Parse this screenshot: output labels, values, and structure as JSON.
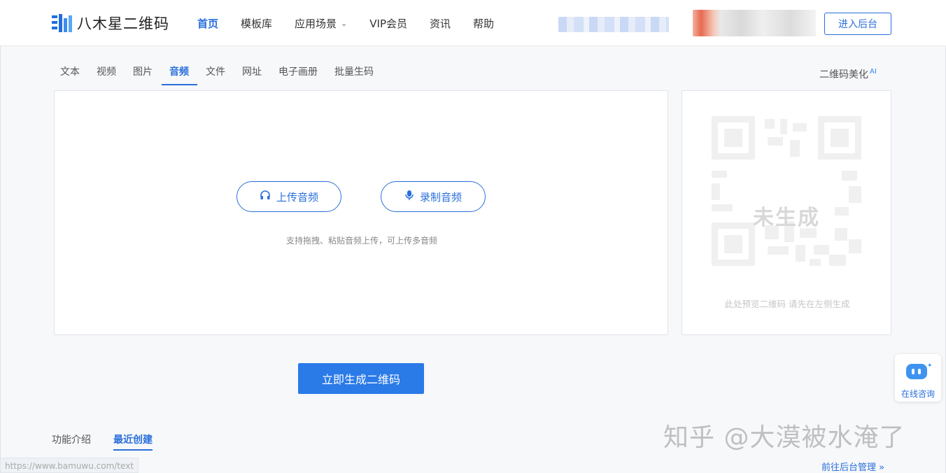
{
  "header": {
    "logo_text": "八木星二维码",
    "nav": [
      {
        "label": "首页"
      },
      {
        "label": "模板库"
      },
      {
        "label": "应用场景"
      },
      {
        "label": "VIP会员"
      },
      {
        "label": "资讯"
      },
      {
        "label": "帮助"
      }
    ],
    "enter_backend": "进入后台"
  },
  "tabs": [
    {
      "label": "文本"
    },
    {
      "label": "视频"
    },
    {
      "label": "图片"
    },
    {
      "label": "音频"
    },
    {
      "label": "文件"
    },
    {
      "label": "网址"
    },
    {
      "label": "电子画册"
    },
    {
      "label": "批量生码"
    }
  ],
  "beautify": {
    "label": "二维码美化",
    "badge": "AI"
  },
  "upload": {
    "upload_label": "上传音频",
    "record_label": "录制音频",
    "hint": "支持拖拽、粘贴音频上传，可上传多音频"
  },
  "preview": {
    "qr_text": "未生成",
    "hint": "此处预览二维码 请先在左侧生成"
  },
  "generate_button": "立即生成二维码",
  "consult": {
    "label": "在线咨询"
  },
  "bottom_tabs": [
    {
      "label": "功能介绍"
    },
    {
      "label": "最近创建"
    }
  ],
  "watermark": "知乎 @大漠被水淹了",
  "status_url": "https://www.bamuwu.com/text",
  "manage_link": "前往后台管理 »",
  "colors": {
    "accent": "#2a6fdb",
    "button": "#2a7ae8"
  },
  "icons": [
    "headphones-icon",
    "microphone-icon",
    "chevron-down-icon",
    "chat-robot-icon"
  ]
}
